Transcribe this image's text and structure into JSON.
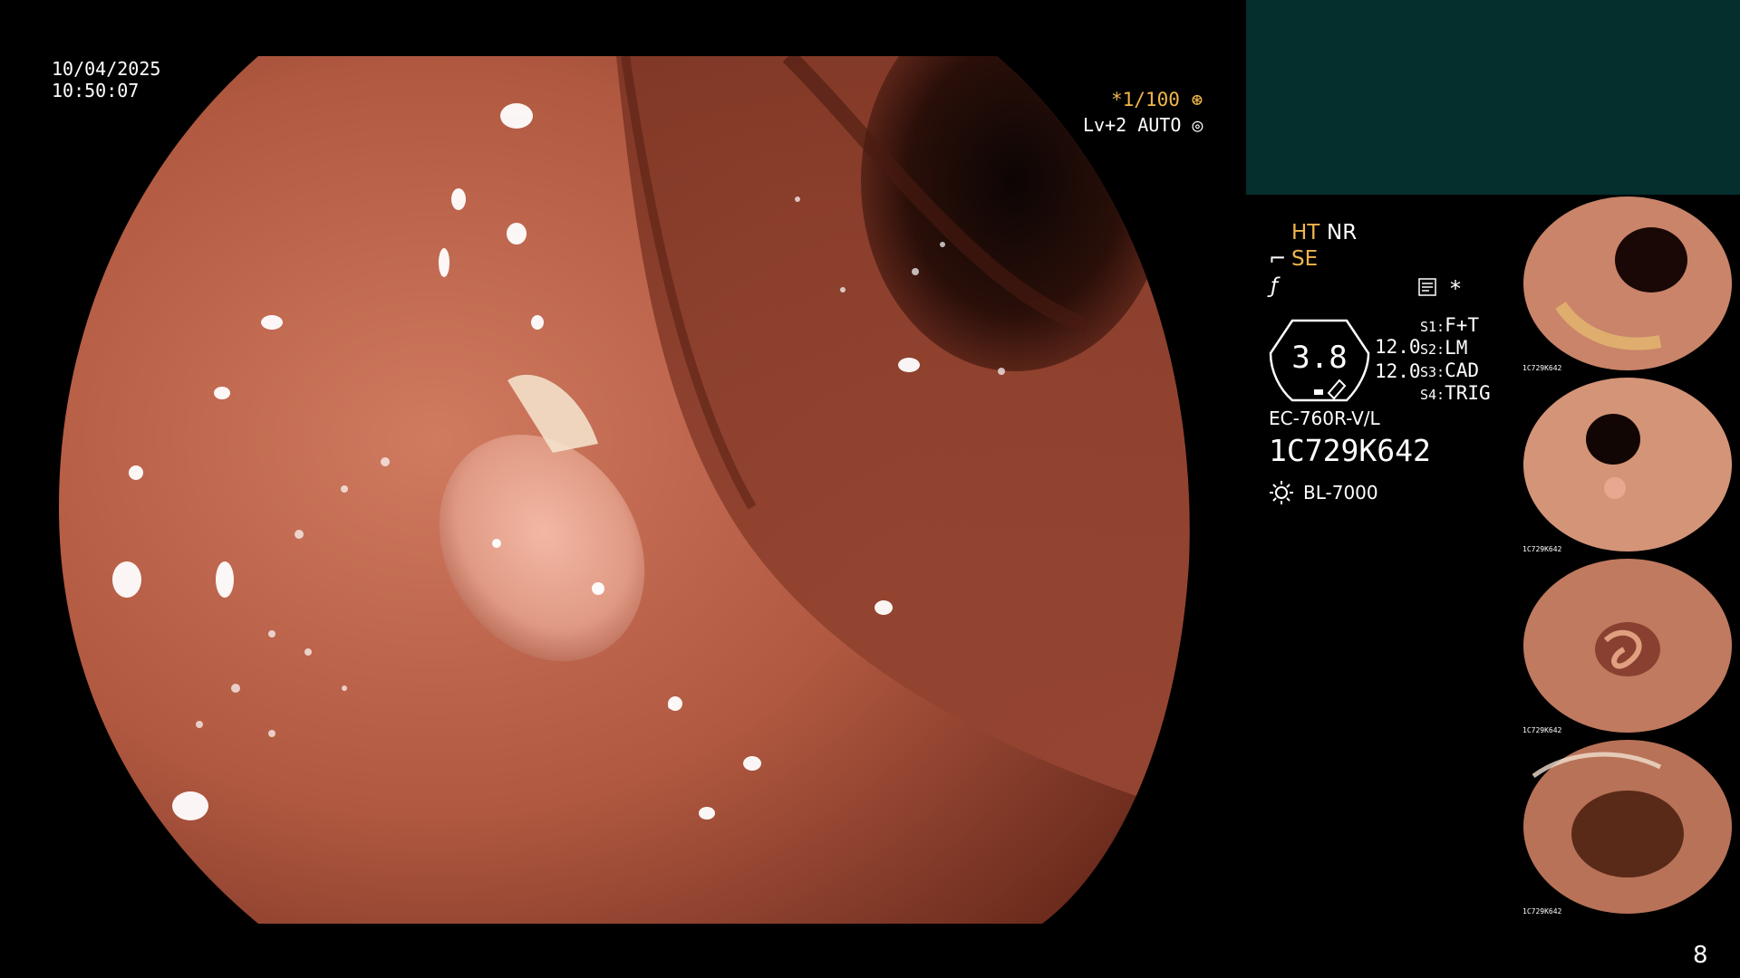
{
  "overlay": {
    "date": "10/04/2025",
    "time": "10:50:07",
    "shutter": "*1/100",
    "iris": "Lv+2 AUTO"
  },
  "settings": {
    "ht": "HT",
    "nr": "NR",
    "se": "SE",
    "star": "*"
  },
  "scope_indicator": {
    "value": "3.8",
    "val1": "12.0",
    "val2": "12.0"
  },
  "switches": [
    {
      "key": "S1:",
      "value": "F+T"
    },
    {
      "key": "S2:",
      "value": "LM"
    },
    {
      "key": "S3:",
      "value": "CAD"
    },
    {
      "key": "S4:",
      "value": "TRIG"
    }
  ],
  "device": {
    "model": "EC-760R-V/L",
    "serial": "1C729K642",
    "light_source": "BL-7000"
  },
  "thumbnails": [
    {
      "label": "1C729K642"
    },
    {
      "label": "1C729K642"
    },
    {
      "label": "1C729K642"
    },
    {
      "label": "1C729K642"
    }
  ],
  "page_number": "8",
  "colors": {
    "accent": "#f0b64a",
    "panel_teal": "#042f2d",
    "mucosa": "#b45a44"
  }
}
